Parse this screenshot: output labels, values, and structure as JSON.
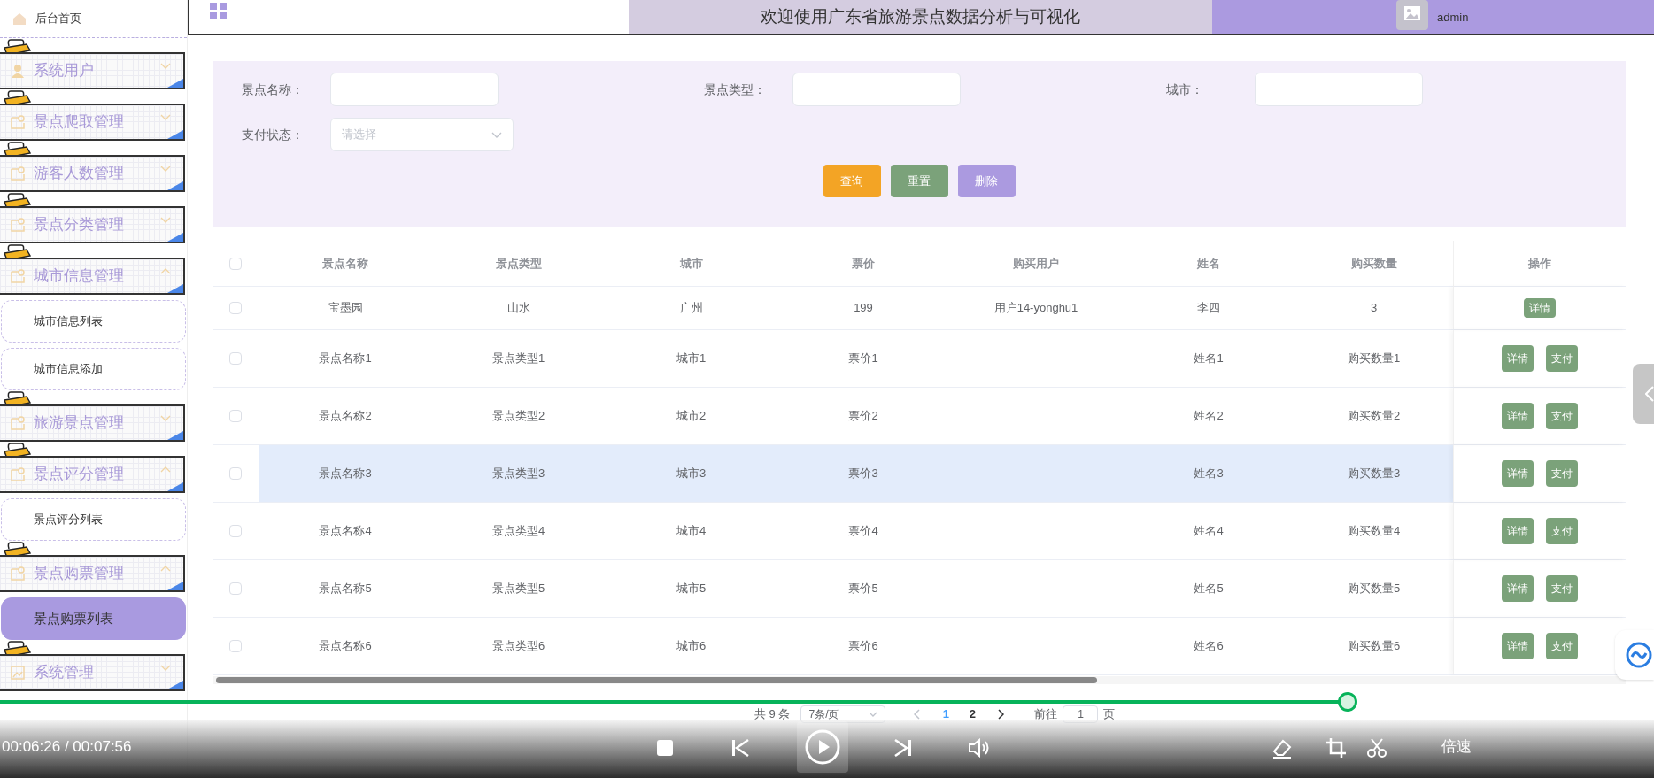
{
  "sidebar": {
    "home": {
      "label": "后台首页"
    },
    "groups": [
      {
        "label": "系统用户",
        "expanded": false
      },
      {
        "label": "景点爬取管理",
        "expanded": false
      },
      {
        "label": "游客人数管理",
        "expanded": false
      },
      {
        "label": "景点分类管理",
        "expanded": false
      },
      {
        "label": "城市信息管理",
        "expanded": true,
        "children": [
          {
            "label": "城市信息列表",
            "selected": false
          },
          {
            "label": "城市信息添加",
            "selected": false
          }
        ]
      },
      {
        "label": "旅游景点管理",
        "expanded": false
      },
      {
        "label": "景点评分管理",
        "expanded": true,
        "children": [
          {
            "label": "景点评分列表",
            "selected": false
          }
        ]
      },
      {
        "label": "景点购票管理",
        "expanded": true,
        "children": [
          {
            "label": "景点购票列表",
            "selected": true
          }
        ]
      },
      {
        "label": "系统管理",
        "expanded": false
      }
    ]
  },
  "header": {
    "title": "欢迎使用广东省旅游景点数据分析与可视化",
    "user": "admin"
  },
  "filters": {
    "fields": [
      {
        "kind": "text",
        "label": "景点名称："
      },
      {
        "kind": "text",
        "label": "景点类型："
      },
      {
        "kind": "text",
        "label": "城市："
      },
      {
        "kind": "select",
        "label": "支付状态：",
        "placeholder": "请选择"
      }
    ],
    "buttons": [
      {
        "kind": "search",
        "label": "查询"
      },
      {
        "kind": "reset",
        "label": "重置"
      },
      {
        "kind": "delete",
        "label": "删除"
      }
    ]
  },
  "table": {
    "select_all": {
      "checked": false
    },
    "columns": [
      "景点名称",
      "景点类型",
      "城市",
      "票价",
      "购买用户",
      "姓名",
      "购买数量",
      "操作"
    ],
    "rows": [
      {
        "checked": false,
        "highlighted": false,
        "name": "宝墨园",
        "type": "山水",
        "city": "广州",
        "price": "199",
        "user": "用户14-yonghu1",
        "real_name": "李四",
        "qty": "3",
        "actions": [
          "详情"
        ]
      },
      {
        "checked": false,
        "highlighted": false,
        "name": "景点名称1",
        "type": "景点类型1",
        "city": "城市1",
        "price": "票价1",
        "real_name": "姓名1",
        "qty": "购买数量1",
        "actions": [
          "详情",
          "支付"
        ]
      },
      {
        "checked": false,
        "highlighted": false,
        "name": "景点名称2",
        "type": "景点类型2",
        "city": "城市2",
        "price": "票价2",
        "real_name": "姓名2",
        "qty": "购买数量2",
        "actions": [
          "详情",
          "支付"
        ]
      },
      {
        "checked": false,
        "highlighted": true,
        "name": "景点名称3",
        "type": "景点类型3",
        "city": "城市3",
        "price": "票价3",
        "real_name": "姓名3",
        "qty": "购买数量3",
        "actions": [
          "详情",
          "支付"
        ]
      },
      {
        "checked": false,
        "highlighted": false,
        "name": "景点名称4",
        "type": "景点类型4",
        "city": "城市4",
        "price": "票价4",
        "real_name": "姓名4",
        "qty": "购买数量4",
        "actions": [
          "详情",
          "支付"
        ]
      },
      {
        "checked": false,
        "highlighted": false,
        "name": "景点名称5",
        "type": "景点类型5",
        "city": "城市5",
        "price": "票价5",
        "real_name": "姓名5",
        "qty": "购买数量5",
        "actions": [
          "详情",
          "支付"
        ]
      },
      {
        "checked": false,
        "highlighted": false,
        "name": "景点名称6",
        "type": "景点类型6",
        "city": "城市6",
        "price": "票价6",
        "real_name": "姓名6",
        "qty": "购买数量6",
        "actions": [
          "详情",
          "支付"
        ]
      }
    ]
  },
  "pagination": {
    "total": "共 9 条",
    "page_size": "7条/页",
    "pages": [
      {
        "label": "1",
        "selected": true
      },
      {
        "label": "2",
        "selected": false
      }
    ],
    "goto_label": "前往",
    "goto_value": "1",
    "goto_suffix": "页"
  },
  "player": {
    "progress": {
      "level": 0.815
    },
    "time": "00:06:26 / 00:07:56",
    "speed": "倍速"
  }
}
